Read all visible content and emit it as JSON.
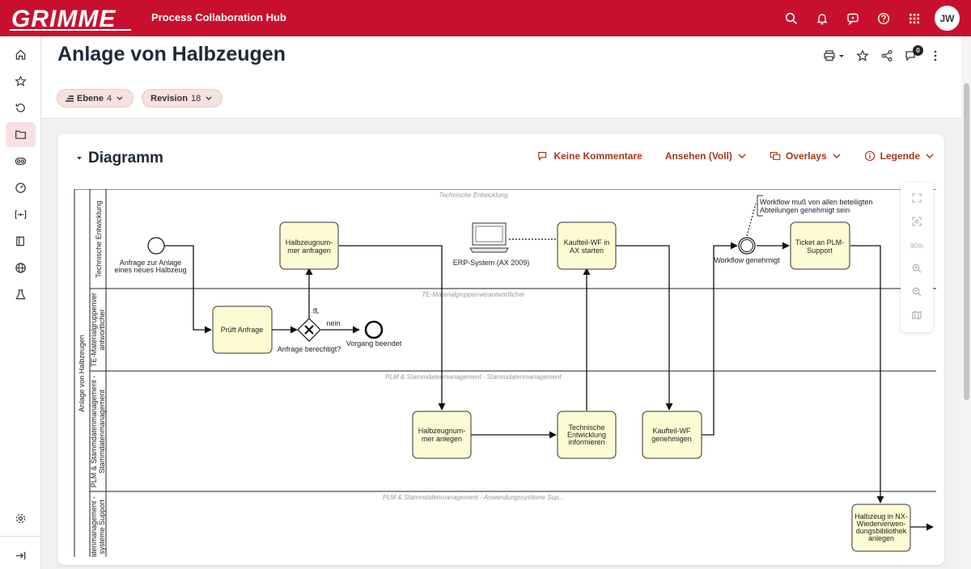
{
  "header": {
    "brand": "GRIMME",
    "app_title": "Process Collaboration Hub",
    "avatar_initials": "JW",
    "brand_color": "#c8102e"
  },
  "page": {
    "title": "Anlage von Halbzeugen",
    "chips": [
      {
        "label": "Ebene",
        "value": "4"
      },
      {
        "label": "Revision",
        "value": "18"
      }
    ],
    "comment_count": "0"
  },
  "card": {
    "title": "Diagramm",
    "actions": {
      "comments": "Keine Kommentare",
      "view": "Ansehen (Voll)",
      "overlays": "Overlays",
      "legend": "Legende"
    },
    "zoom_level": "90%"
  },
  "diagram": {
    "pool_label": "Anlage von Halbzeugen",
    "lanes": [
      {
        "label": "Technische Entwicklung",
        "sub": "Technische Entwicklung"
      },
      {
        "label_1": "TE-Materialgruppenver",
        "label_2": "antwortlicher",
        "sub": "TE-Materialgruppenverantwortlicher"
      },
      {
        "label_1": "PLM & Stammdatenmanagement -",
        "label_2": "Stammdatenmanagement",
        "sub": "PLM & Stammdatenmanagement - Stammdatenmanagement"
      },
      {
        "label_1": "atenmanagement -",
        "label_2": "systeme Support",
        "sub": "PLM & Stammdatenmanagement - Anwendungssysteme Sup..."
      }
    ],
    "start_event_1": "Anfrage zur Anlage",
    "start_event_2": "eines neues Halbzeug",
    "task_halbzeugnummer_anfragen_1": "Halbzeugnum-",
    "task_halbzeugnummer_anfragen_2": "mer anfragen",
    "erp_system": "ERP-System (AX 2009)",
    "task_kaufteil_starten_1": "Kaufteil-WF in",
    "task_kaufteil_starten_2": "AX starten",
    "annotation_1": "Workflow muß von allen beteiligten",
    "annotation_2": "Abteilungen genehmigt sein",
    "event_workflow_genehmigt": "Workflow genehmigt",
    "task_ticket_1": "Ticket an PLM-",
    "task_ticket_2": "Support",
    "task_prueft_anfrage": "Prüft Anfrage",
    "gateway_label": "Anfrage berechtigt?",
    "flow_ja": "ja",
    "flow_nein": "nein",
    "end_event": "Vorgang beendet",
    "task_halbzeugnummer_anlegen_1": "Halbzeugnum-",
    "task_halbzeugnummer_anlegen_2": "mer anlegen",
    "task_te_informieren_1": "Technische",
    "task_te_informieren_2": "Entwicklung",
    "task_te_informieren_3": "informieren",
    "task_kaufteil_genehmigen_1": "Kaufteil-WF",
    "task_kaufteil_genehmigen_2": "genehmigen",
    "task_bibliothek_1": "Halbzeug in NX-",
    "task_bibliothek_2": "Wiederverwen-",
    "task_bibliothek_3": "dungsbibliothek",
    "task_bibliothek_4": "anlegen"
  }
}
